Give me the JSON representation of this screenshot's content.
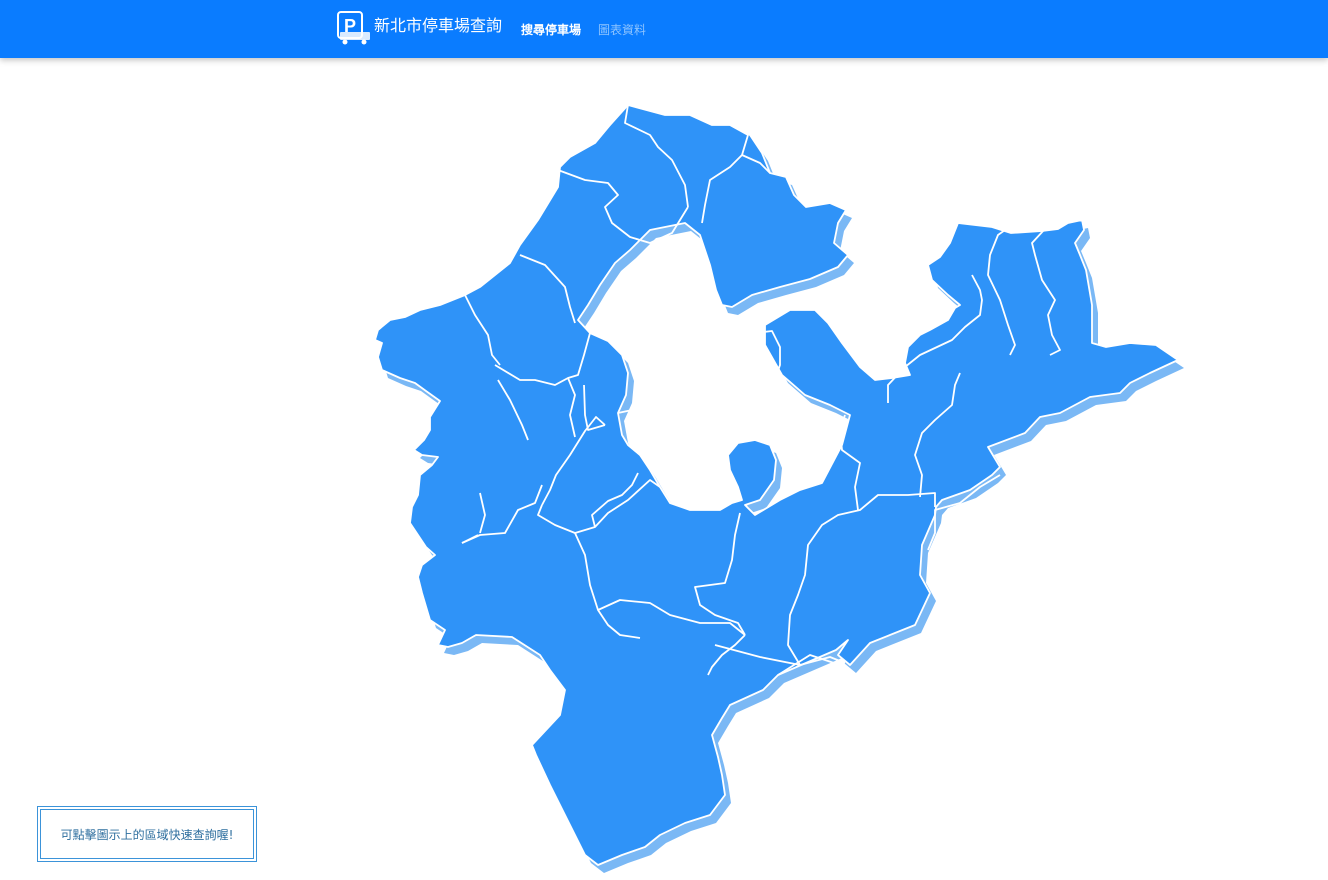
{
  "header": {
    "title": "新北市停車場查詢",
    "nav": [
      {
        "label": "搜尋停車場",
        "active": true
      },
      {
        "label": "圖表資料",
        "active": false
      }
    ],
    "logo_icon": "parking-truck-icon"
  },
  "hint": {
    "text": "可點擊圖示上的區域快速查詢喔!"
  },
  "colors": {
    "navbar": "#0a7cff",
    "map_fill": "#2f93f8",
    "map_shadow": "#7ab8f5",
    "map_border": "#ffffff",
    "hint_border": "#3b93d9"
  }
}
